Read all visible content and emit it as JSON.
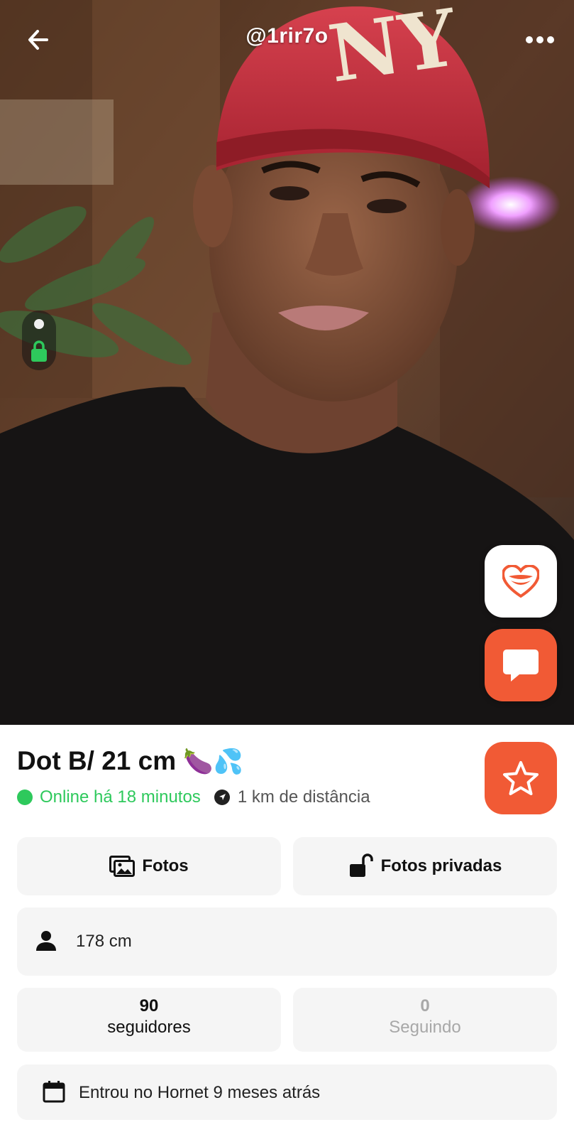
{
  "header": {
    "username": "@1rir7o",
    "back_icon": "arrow-left-icon",
    "more_icon": "more-horizontal-icon"
  },
  "photo": {
    "description_icon": "profile-photo",
    "pager_icons": [
      "dot-icon",
      "lock-icon"
    ],
    "lock_color": "#2ec95c"
  },
  "actions": {
    "like_icon": "heart-lips-icon",
    "chat_icon": "chat-bubble-icon",
    "favorite_icon": "star-icon",
    "accent_color": "#f15a35"
  },
  "profile": {
    "name": "Dot B/ 21 cm",
    "name_emoji": "🍆💦",
    "online_status": "Online há 18 minutos",
    "online_color": "#2ec95c",
    "distance": "1 km de distância"
  },
  "buttons": {
    "photos_label": "Fotos",
    "private_photos_label": "Fotos privadas"
  },
  "details": {
    "height": "178 cm"
  },
  "stats": {
    "followers_count": "90",
    "followers_label": "seguidores",
    "following_count": "0",
    "following_label": "Seguindo"
  },
  "joined": {
    "text": "Entrou no Hornet 9 meses atrás"
  }
}
